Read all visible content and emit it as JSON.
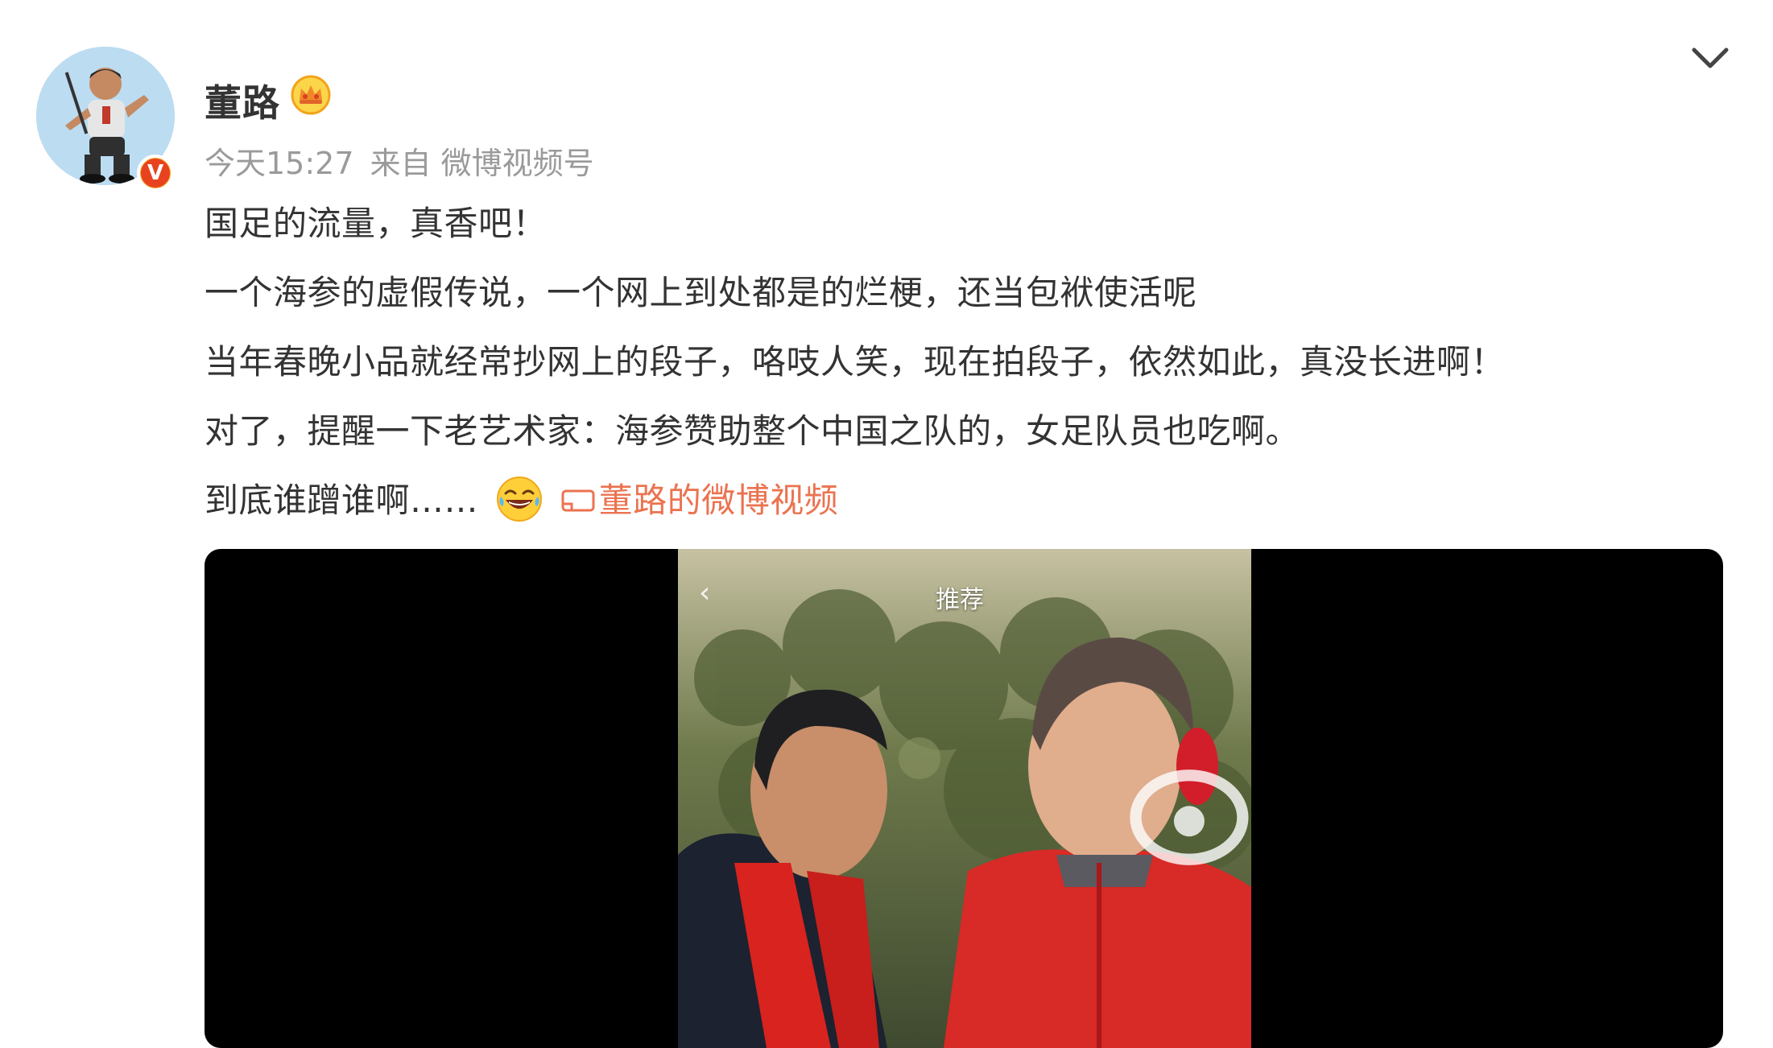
{
  "post": {
    "username": "董路",
    "timestamp": "今天15:27",
    "source": "来自 微博视频号",
    "lines": [
      "国足的流量，真香吧！",
      "一个海参的虚假传说，一个网上到处都是的烂梗，还当包袱使活呢",
      "当年春晚小品就经常抄网上的段子，咯吱人笑，现在拍段子，依然如此，真没长进啊！",
      "对了，提醒一下老艺术家：海参赞助整个中国之队的，女足队员也吃啊。",
      "到底谁蹭谁啊……"
    ],
    "video_link_label": "董路的微博视频",
    "icons": {
      "vip": "vip-crown-icon",
      "verified": "verified-v-icon",
      "more": "chevron-down-icon",
      "emoji": "laugh-cry-emoji-icon",
      "video_link": "video-link-icon"
    },
    "verified_letter": "V"
  },
  "video": {
    "overlay_tag": "推荐",
    "back_glyph": "‹"
  },
  "colors": {
    "link": "#eb7350",
    "meta": "#9a9a9a",
    "text": "#333333",
    "verified": "#e8431f",
    "vip": "#f6b41f"
  }
}
